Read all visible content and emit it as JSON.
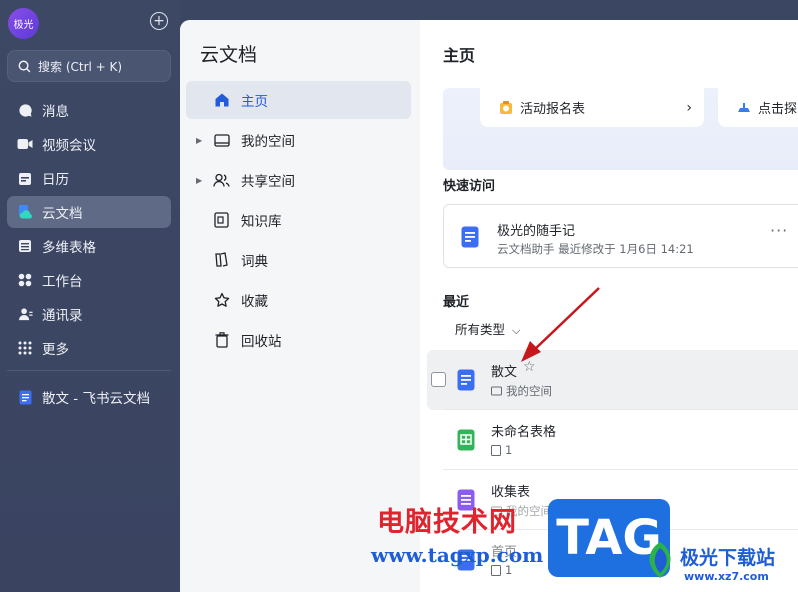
{
  "nav": {
    "avatar_text": "极光",
    "search_placeholder": "搜索 (Ctrl + K)",
    "items": [
      {
        "label": "消息",
        "icon": "message-icon"
      },
      {
        "label": "视频会议",
        "icon": "video-icon"
      },
      {
        "label": "日历",
        "icon": "calendar-icon"
      },
      {
        "label": "云文档",
        "icon": "cloud-doc-icon",
        "active": true
      },
      {
        "label": "多维表格",
        "icon": "table-icon"
      },
      {
        "label": "工作台",
        "icon": "workbench-icon"
      },
      {
        "label": "通讯录",
        "icon": "contacts-icon"
      },
      {
        "label": "更多",
        "icon": "more-grid-icon"
      }
    ],
    "open_doc": "散文 - 飞书云文档"
  },
  "docs_side": {
    "title": "云文档",
    "items": [
      {
        "label": "主页",
        "active": true
      },
      {
        "label": "我的空间",
        "expandable": true
      },
      {
        "label": "共享空间",
        "expandable": true
      },
      {
        "label": "知识库"
      },
      {
        "label": "词典"
      },
      {
        "label": "收藏"
      },
      {
        "label": "回收站"
      }
    ]
  },
  "main": {
    "title": "主页",
    "cards": {
      "card1": "活动报名表",
      "card2": "点击探"
    },
    "quick_access": {
      "heading": "快速访问",
      "name": "极光的随手记",
      "sub": "云文档助手 最近修改于 1月6日 14:21",
      "more": "···"
    },
    "recent": {
      "heading": "最近",
      "filter": "所有类型",
      "rows": [
        {
          "name": "散文",
          "sub": "我的空间"
        },
        {
          "name": "未命名表格",
          "sub": "1"
        },
        {
          "name": "收集表",
          "sub": "我的空间"
        },
        {
          "name": "首页",
          "sub": "1"
        }
      ]
    }
  },
  "watermark": {
    "red_text": "电脑技术网",
    "url": "www.tagxp.com",
    "tag": "TAG",
    "cn_site": "极光下载站",
    "url2": "www.xz7.com"
  },
  "colors": {
    "accent": "#245bdb",
    "nav_bg": "#3d4865",
    "annotation_arrow": "#c8161d"
  }
}
